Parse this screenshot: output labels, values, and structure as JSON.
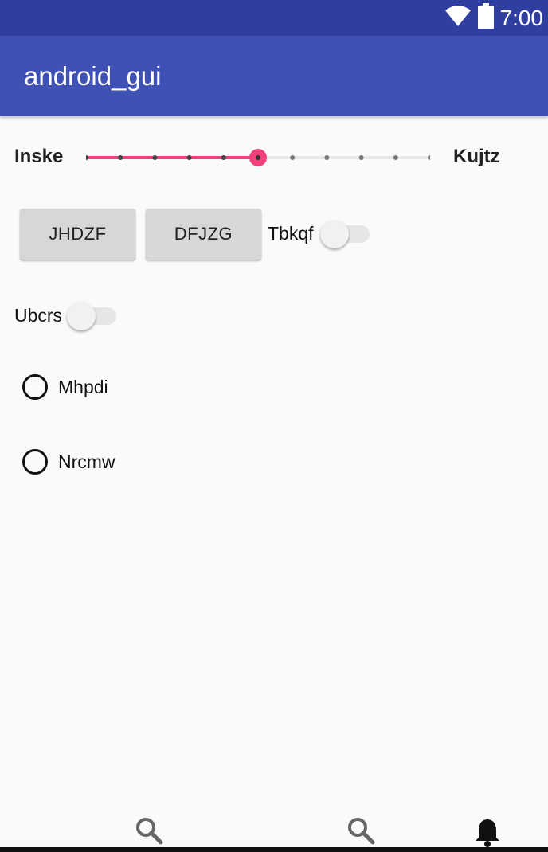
{
  "status_bar": {
    "time": "7:00",
    "icons": [
      "wifi-icon",
      "battery-icon"
    ]
  },
  "app_bar": {
    "title": "android_gui"
  },
  "seekbar": {
    "left_label": "Inske",
    "right_label": "Kujtz",
    "steps": 10,
    "value": 5
  },
  "buttons": {
    "first": "JHDZF",
    "second": "DFJZG"
  },
  "switches": [
    {
      "label": "Tbkqf",
      "checked": false
    },
    {
      "label": "Ubcrs",
      "checked": false
    }
  ],
  "radios": [
    {
      "label": "Mhpdi",
      "checked": false
    },
    {
      "label": "Nrcmw",
      "checked": false
    }
  ],
  "bottom_nav": [
    "search-icon",
    "search-icon",
    "bell-icon"
  ],
  "colors": {
    "status_bar": "#303f9f",
    "app_bar": "#3f51b5",
    "accent": "#ff4081",
    "background": "#fafafa"
  }
}
